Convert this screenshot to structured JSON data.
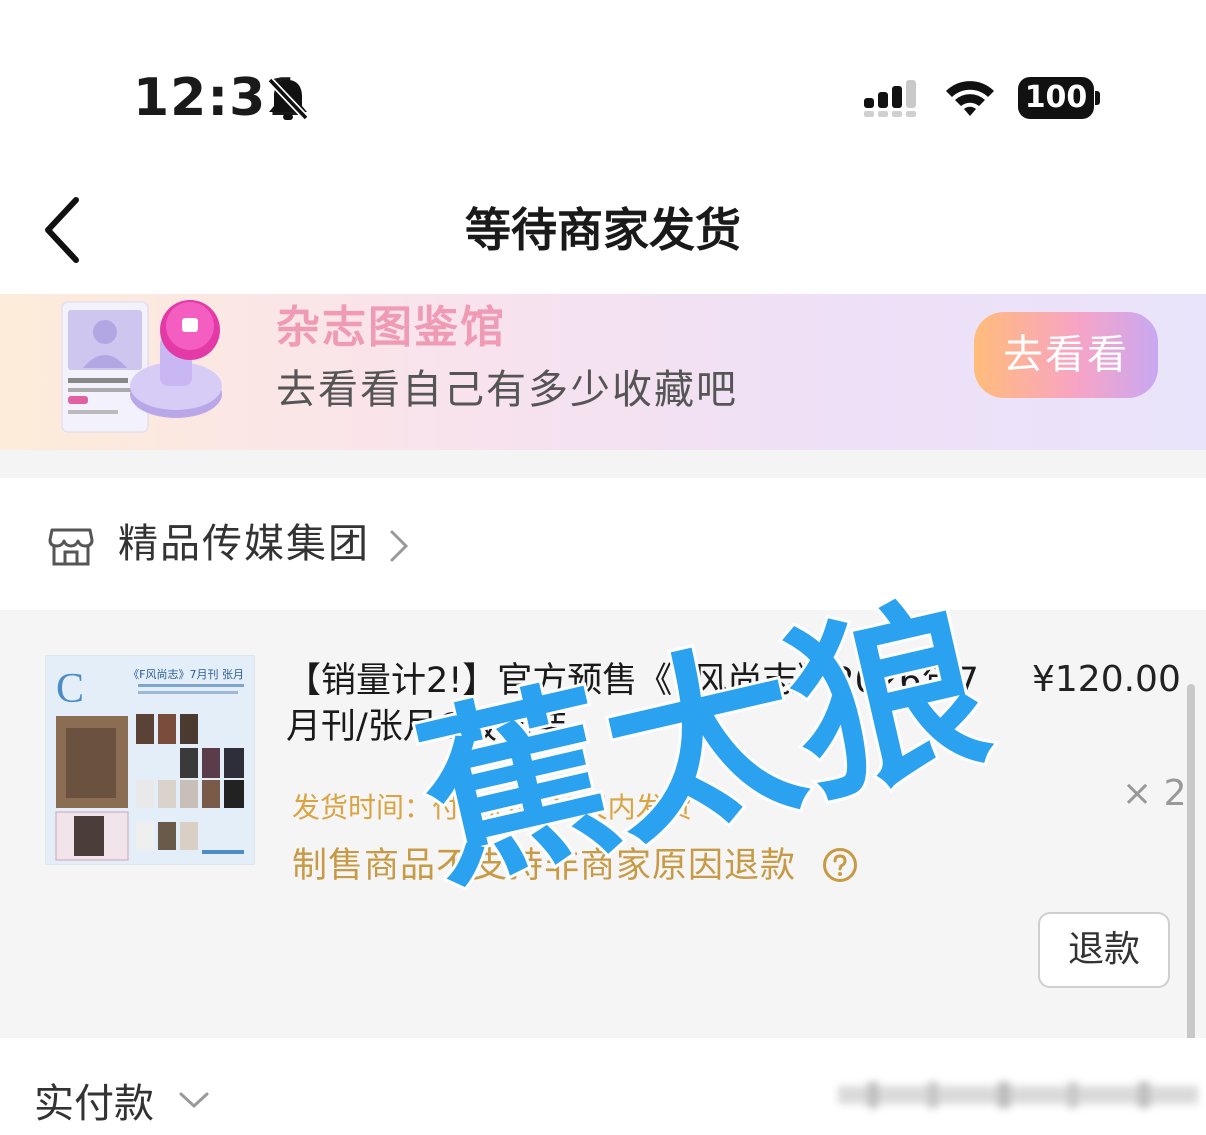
{
  "status_bar": {
    "time": "12:31",
    "battery": "100"
  },
  "nav": {
    "title": "等待商家发货"
  },
  "banner": {
    "title": "杂志图鉴馆",
    "subtitle": "去看看自己有多少收藏吧",
    "button_label": "去看看"
  },
  "shop": {
    "name": "精品传媒集团"
  },
  "product": {
    "title": "【销量计2!】官方预售《F风尚志》2026年7月刊/张月C版套装",
    "price": "¥120.00",
    "quantity": "× 2",
    "ship_time": "发货时间：付款后约30天内发货",
    "refund_notice": "制售商品不支持非商家原因退款",
    "refund_button": "退款",
    "thumbnail": {
      "letter": "C",
      "caption": "《F风尚志》7月刊 张月"
    }
  },
  "payment": {
    "label": "实付款"
  },
  "watermark": {
    "text": "蕉太狼",
    "color": "#2aa2f0"
  },
  "colors": {
    "accent_gold": "#c79a45",
    "banner_pink": "#ef9bb6",
    "watermark_blue": "#2aa2f0"
  },
  "icons": [
    "bell-off-icon",
    "signal-icon",
    "wifi-icon",
    "battery-icon",
    "back-arrow-icon",
    "stamp-illustration",
    "shop-icon",
    "chevron-right-icon",
    "help-circle-icon",
    "chevron-down-icon"
  ]
}
